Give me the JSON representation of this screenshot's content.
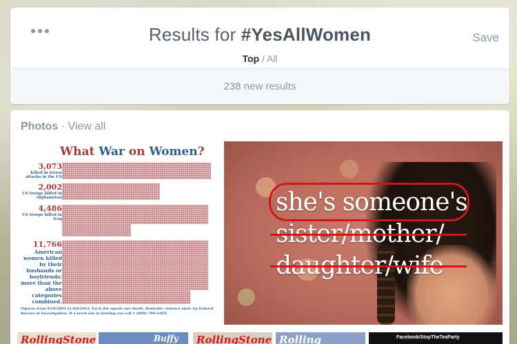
{
  "header": {
    "title_prefix": "Results for ",
    "title_hashtag": "#YesAllWomen",
    "save_label": "Save",
    "filter_top": "Top",
    "filter_sep": " / ",
    "filter_all": "All",
    "new_results": "238 new results"
  },
  "photos": {
    "label": "Photos",
    "separator": " · ",
    "view_all": "View all"
  },
  "infographic": {
    "title_pre": "What ",
    "title_war": "War",
    "title_mid": " on ",
    "title_women": "Women",
    "title_q": "?",
    "stats": [
      {
        "number": "3,073",
        "desc": "killed in terror attacks in the US",
        "value": 3073
      },
      {
        "number": "2,002",
        "desc": "US troops killed in Afghanistan",
        "value": 2002
      },
      {
        "number": "4,486",
        "desc": "US troops killed in Iraq",
        "value": 4486
      },
      {
        "number": "11,766",
        "desc": "American women killed by their husbands or boyfriends: more than the above categories combined.",
        "value": 11766
      }
    ],
    "footnote": "Figures from 9/10/2001 to 6/6/2012. Each dot equals one death. Domestic violence stats via Federal Bureau of Investigation. If a loved one is hurting you call 1 (800) 799-SAFE."
  },
  "quote_image": {
    "line1": "she's someone's",
    "line2": "sister/mother/",
    "line3": "daughter/wife"
  },
  "thumbs": [
    {
      "text": "RollingStone",
      "bg": "#e8e0d0"
    },
    {
      "text": "Buffy",
      "bg": "#6a8fbf"
    },
    {
      "text": "RollingStone",
      "bg": "#d8cfc0"
    },
    {
      "text": "Rolling",
      "bg": "#8aa0c8"
    },
    {
      "text": "Facebook/StopTheTeaParty",
      "bg": "#111111"
    }
  ]
}
